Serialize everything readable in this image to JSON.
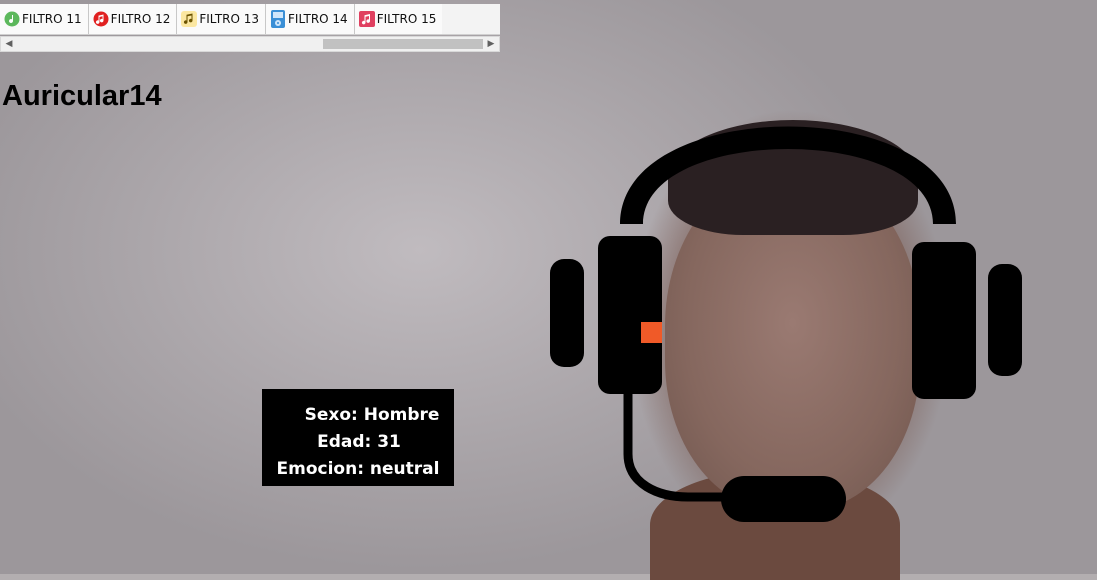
{
  "tabs": [
    {
      "label": "FILTRO 11",
      "icon": "green-music-note-icon",
      "color": "#5cb85c"
    },
    {
      "label": "FILTRO 12",
      "icon": "red-music-note-icon",
      "color": "#e02020"
    },
    {
      "label": "FILTRO 13",
      "icon": "yellow-music-notes-icon",
      "color": "#f0c419"
    },
    {
      "label": "FILTRO 14",
      "icon": "media-player-icon",
      "color": "#3a8fd6"
    },
    {
      "label": "FILTRO 15",
      "icon": "music-file-icon",
      "color": "#e04060"
    }
  ],
  "page": {
    "title": "Auricular14"
  },
  "info": {
    "sexo": "Sexo: Hombre",
    "edad": "Edad: 31",
    "emocion": "Emocion: neutral"
  },
  "colors": {
    "headset": "#000000",
    "indicator": "#f05a28"
  }
}
